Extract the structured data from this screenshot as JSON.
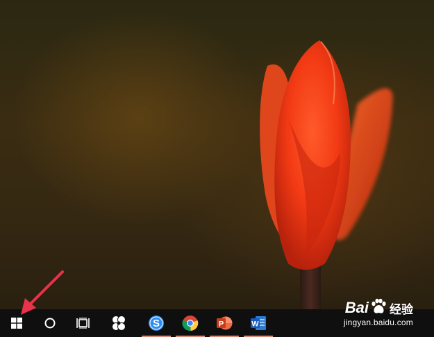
{
  "wallpaper": {
    "subject": "red tulip",
    "accent": "#e8401c"
  },
  "taskbar": {
    "background": "#0f0f0f",
    "items": [
      {
        "name": "start",
        "icon": "windows-logo-icon"
      },
      {
        "name": "search",
        "icon": "cortana-circle-icon"
      },
      {
        "name": "task-view",
        "icon": "task-view-icon"
      },
      {
        "name": "pinned-app",
        "icon": "pinwheel-app-icon"
      },
      {
        "name": "sogou",
        "icon": "sogou-s-icon"
      },
      {
        "name": "chrome",
        "icon": "chrome-icon"
      },
      {
        "name": "powerpoint",
        "icon": "powerpoint-icon"
      },
      {
        "name": "word",
        "icon": "word-icon"
      }
    ]
  },
  "annotation": {
    "color": "#e8334a"
  },
  "watermark": {
    "brand_left": "Bai",
    "brand_right": "经验",
    "url": "jingyan.baidu.com"
  }
}
